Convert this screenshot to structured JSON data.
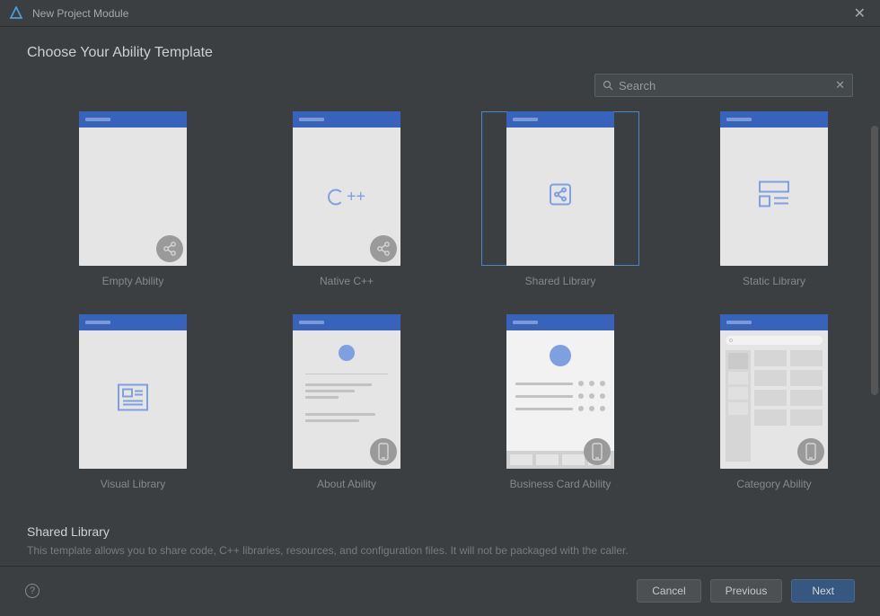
{
  "titlebar": {
    "title": "New Project Module"
  },
  "heading": "Choose Your Ability Template",
  "search": {
    "placeholder": "Search"
  },
  "templates": [
    {
      "id": "empty-ability",
      "label": "Empty Ability",
      "preview": "empty",
      "corner": "share",
      "selected": false
    },
    {
      "id": "native-cpp",
      "label": "Native C++",
      "preview": "cpp",
      "corner": "share",
      "selected": false
    },
    {
      "id": "shared-library",
      "label": "Shared Library",
      "preview": "share-icon",
      "corner": null,
      "selected": true
    },
    {
      "id": "static-library",
      "label": "Static Library",
      "preview": "list-icon",
      "corner": null,
      "selected": false
    },
    {
      "id": "visual-library",
      "label": "Visual Library",
      "preview": "doc-icon",
      "corner": null,
      "selected": false
    },
    {
      "id": "about-ability",
      "label": "About Ability",
      "preview": "about",
      "corner": "phone",
      "selected": false
    },
    {
      "id": "business-card-ability",
      "label": "Business Card Ability",
      "preview": "bizcard",
      "corner": "phone",
      "selected": false
    },
    {
      "id": "category-ability",
      "label": "Category Ability",
      "preview": "category",
      "corner": "phone",
      "selected": false
    }
  ],
  "selected": {
    "title": "Shared Library",
    "description": "This template allows you to share code, C++ libraries, resources, and configuration files. It will not be packaged with the caller."
  },
  "footer": {
    "cancel": "Cancel",
    "previous": "Previous",
    "next": "Next"
  }
}
